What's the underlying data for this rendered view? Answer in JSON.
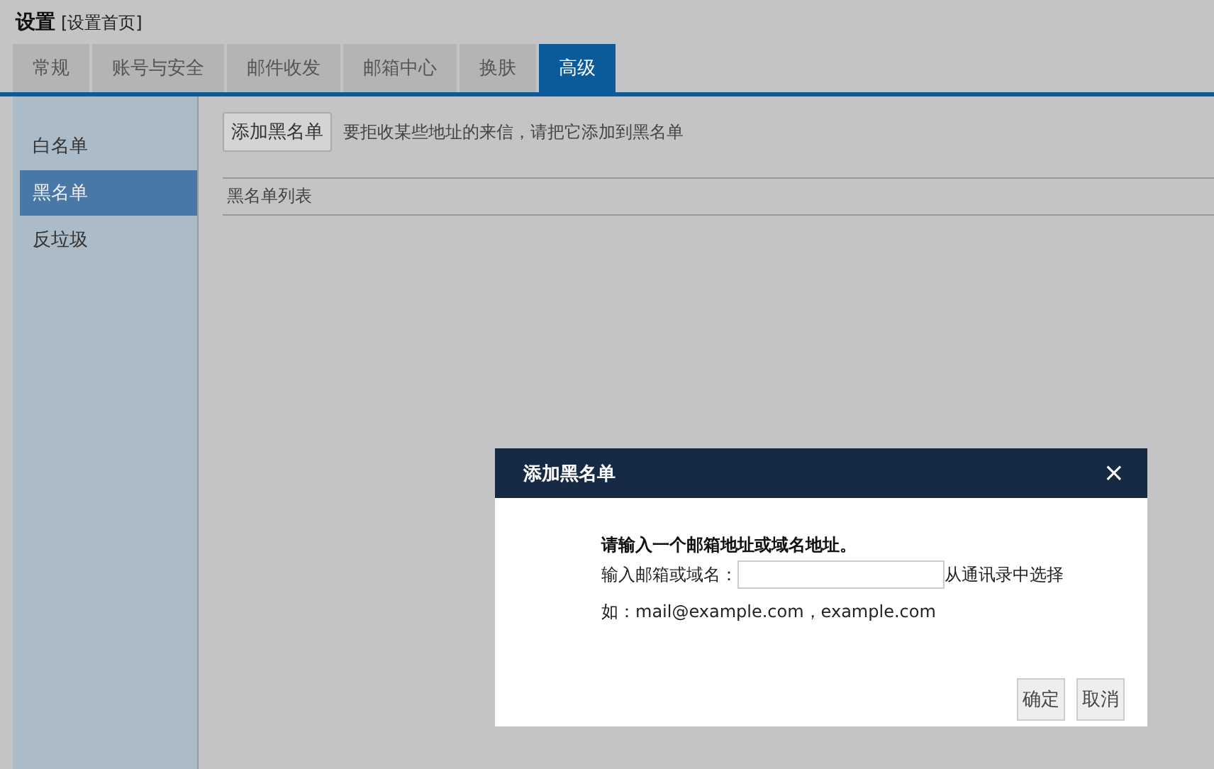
{
  "header": {
    "title": "设置",
    "subtitle": "[设置首页]"
  },
  "tabs": [
    {
      "label": "常规",
      "selected": false
    },
    {
      "label": "账号与安全",
      "selected": false
    },
    {
      "label": "邮件收发",
      "selected": false
    },
    {
      "label": "邮箱中心",
      "selected": false
    },
    {
      "label": "换肤",
      "selected": false
    },
    {
      "label": "高级",
      "selected": true
    }
  ],
  "sidebar": {
    "items": [
      {
        "label": "白名单",
        "selected": false
      },
      {
        "label": "黑名单",
        "selected": true
      },
      {
        "label": "反垃圾",
        "selected": false
      }
    ]
  },
  "content": {
    "add_button": "添加黑名单",
    "hint": "要拒收某些地址的来信，请把它添加到黑名单",
    "list_header": "黑名单列表"
  },
  "dialog": {
    "title": "添加黑名单",
    "close": "×",
    "instruction": "请输入一个邮箱地址或域名地址。",
    "field_label": "输入邮箱或域名：",
    "contacts_link": "从通讯录中选择",
    "example": "如：mail@example.com，example.com",
    "buttons": [
      "确定",
      "取消"
    ]
  }
}
